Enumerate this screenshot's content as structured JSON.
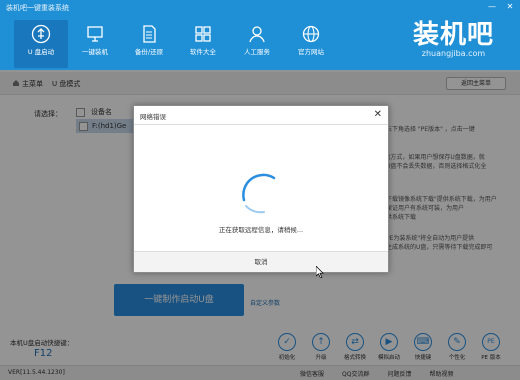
{
  "window": {
    "title": "装机吧一键重装系统",
    "minimize": "—",
    "close": "✕"
  },
  "nav": [
    {
      "label": "U 盘启动",
      "icon": "usb-icon"
    },
    {
      "label": "一键装机",
      "icon": "monitor-icon"
    },
    {
      "label": "备份/还原",
      "icon": "document-icon"
    },
    {
      "label": "软件大全",
      "icon": "grid-icon"
    },
    {
      "label": "人工服务",
      "icon": "person-icon"
    },
    {
      "label": "官方网站",
      "icon": "globe-icon"
    }
  ],
  "brand": {
    "name": "装机吧",
    "site": "zhuangjiba.com"
  },
  "breadcrumb": {
    "first": "主菜单",
    "second": "U 盘模式",
    "back": "返回主菜单"
  },
  "main": {
    "select_label": "请选择：",
    "device_header": "设备名",
    "device_row": "F:(hd1)Ge",
    "tips": [
      "，右下角选择 \"PE版本\" ，点击一键",
      "U盘方式，如果用户想保存U盘数据，就",
      "到U盘不会丢失数据，否则选择格式化全",
      "，下载镜像系统下载\"提供系统下载，为用户",
      "，保证用户有系统可装，为用户",
      "提供系统下载",
      "，PE为装系统\"将全自动为用户提供",
      "在生成系统的U盘，只需等待下载完成即可"
    ],
    "primary_button": "一键制作启动U盘",
    "custom_params": "自定义参数"
  },
  "footer": {
    "shortcut_label": "本机U盘启动快捷键：",
    "shortcut_key": "F12",
    "tools": [
      {
        "label": "初始化",
        "icon": "check-icon",
        "glyph": "✓"
      },
      {
        "label": "升级",
        "icon": "up-arrow-icon",
        "glyph": "↑"
      },
      {
        "label": "格式转换",
        "icon": "convert-icon",
        "glyph": "⇄"
      },
      {
        "label": "模拟启动",
        "icon": "play-icon",
        "glyph": "▶"
      },
      {
        "label": "快捷键",
        "icon": "keyboard-icon",
        "glyph": "⌨"
      },
      {
        "label": "个性化",
        "icon": "brush-icon",
        "glyph": "✎"
      },
      {
        "label": "PE 版本",
        "icon": "pe-icon",
        "glyph": "PE"
      }
    ],
    "version": "VER[11.5.44.1230]",
    "links": [
      "微信客服",
      "QQ交流群",
      "问题反馈",
      "帮助视频"
    ]
  },
  "dialog": {
    "title": "网络错误",
    "close": "✕",
    "message": "正在获取远程信息，请稍候...",
    "cancel": "取消"
  },
  "colors": {
    "brand_blue": "#1f8fd6",
    "button_blue": "#2a8ee0"
  }
}
